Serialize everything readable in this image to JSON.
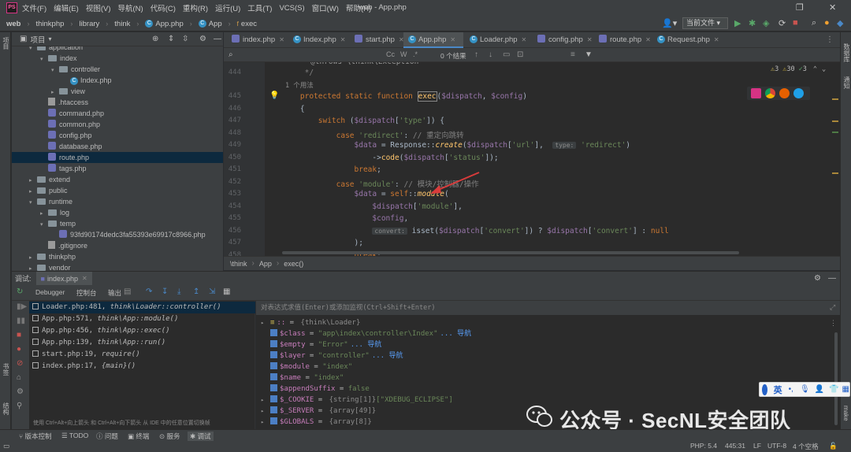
{
  "menubar": {
    "items": [
      "文件(F)",
      "编辑(E)",
      "视图(V)",
      "导航(N)",
      "代码(C)",
      "重构(R)",
      "运行(U)",
      "工具(T)",
      "VCS(S)",
      "窗口(W)",
      "帮助(H)"
    ],
    "title": "web - App.php"
  },
  "navbar": {
    "crumbs": [
      "web",
      "thinkphp",
      "library",
      "think",
      "App.php",
      "App",
      "exec"
    ],
    "run_config": "当前文件"
  },
  "project": {
    "title": "项目",
    "tree": [
      {
        "label": "application",
        "indent": 1,
        "kind": "folder",
        "arrow": "▾"
      },
      {
        "label": "index",
        "indent": 2,
        "kind": "folder",
        "arrow": "▾"
      },
      {
        "label": "controller",
        "indent": 3,
        "kind": "folder",
        "arrow": "▾"
      },
      {
        "label": "Index.php",
        "indent": 4,
        "kind": "class",
        "arrow": ""
      },
      {
        "label": "view",
        "indent": 3,
        "kind": "folder",
        "arrow": "▸"
      },
      {
        "label": ".htaccess",
        "indent": 2,
        "kind": "file",
        "arrow": ""
      },
      {
        "label": "command.php",
        "indent": 2,
        "kind": "php",
        "arrow": ""
      },
      {
        "label": "common.php",
        "indent": 2,
        "kind": "php",
        "arrow": ""
      },
      {
        "label": "config.php",
        "indent": 2,
        "kind": "php",
        "arrow": ""
      },
      {
        "label": "database.php",
        "indent": 2,
        "kind": "php",
        "arrow": ""
      },
      {
        "label": "route.php",
        "indent": 2,
        "kind": "php",
        "arrow": "",
        "selected": true
      },
      {
        "label": "tags.php",
        "indent": 2,
        "kind": "php",
        "arrow": ""
      },
      {
        "label": "extend",
        "indent": 1,
        "kind": "folder",
        "arrow": "▸"
      },
      {
        "label": "public",
        "indent": 1,
        "kind": "folder",
        "arrow": "▸"
      },
      {
        "label": "runtime",
        "indent": 1,
        "kind": "folder",
        "arrow": "▾"
      },
      {
        "label": "log",
        "indent": 2,
        "kind": "folder",
        "arrow": "▸"
      },
      {
        "label": "temp",
        "indent": 2,
        "kind": "folder",
        "arrow": "▾"
      },
      {
        "label": "93fd90174dedc3fa55393e69917c8966.php",
        "indent": 3,
        "kind": "php",
        "arrow": ""
      },
      {
        "label": ".gitignore",
        "indent": 2,
        "kind": "file",
        "arrow": ""
      },
      {
        "label": "thinkphp",
        "indent": 1,
        "kind": "folder",
        "arrow": "▸"
      },
      {
        "label": "vendor",
        "indent": 1,
        "kind": "folder",
        "arrow": "▸"
      }
    ]
  },
  "editor": {
    "tabs": [
      "index.php",
      "Index.php",
      "start.php",
      "App.php",
      "Loader.php",
      "config.php",
      "route.php",
      "Request.php"
    ],
    "active_tab": "App.php",
    "find_results": "0 个结果",
    "inspections": {
      "warnings": "3",
      "weak": "30",
      "typos": "3"
    },
    "usages_hint": "1 个用法",
    "lines": [
      {
        "n": "444",
        "html": "<span class=\"cmt\">     */</span>"
      },
      {
        "n": "445",
        "html": "    <span class=\"kw\">protected static function</span> <span class=\"fn\" style=\"border:1px solid #888;\">exec</span>(<span class=\"var\">$dispatch</span>, <span class=\"var\">$config</span>)"
      },
      {
        "n": "446",
        "html": "    {"
      },
      {
        "n": "447",
        "html": "        <span class=\"kw\">switch</span> (<span class=\"var\">$dispatch</span>[<span class=\"str\">'type'</span>]) {"
      },
      {
        "n": "448",
        "html": "            <span class=\"kw\">case</span> <span class=\"str\">'redirect'</span>: <span class=\"cmt\">// 重定向跳转</span>"
      },
      {
        "n": "449",
        "html": "                <span class=\"var\">$data</span> = Response::<span class=\"it\">create</span>(<span class=\"var\">$dispatch</span>[<span class=\"str\">'url'</span>],  <span class=\"hint\">type:</span> <span class=\"str\">'redirect'</span>)"
      },
      {
        "n": "450",
        "html": "                    -><span class=\"fn\">code</span>(<span class=\"var\">$dispatch</span>[<span class=\"str\">'status'</span>]);"
      },
      {
        "n": "451",
        "html": "                <span class=\"kw\">break</span>;"
      },
      {
        "n": "452",
        "html": "            <span class=\"kw\">case</span> <span class=\"str\">'module'</span>: <span class=\"cmt\">// 模块/控制器/操作</span>"
      },
      {
        "n": "453",
        "html": "                <span class=\"var\">$data</span> = <span class=\"kw\">self</span>::<span class=\"it\">module</span>("
      },
      {
        "n": "454",
        "html": "                    <span class=\"var\">$dispatch</span>[<span class=\"str\">'module'</span>],"
      },
      {
        "n": "455",
        "html": "                    <span class=\"var\">$config</span>,"
      },
      {
        "n": "456",
        "html": "                    <span class=\"hint\">convert:</span> isset(<span class=\"var\">$dispatch</span>[<span class=\"str\">'convert'</span>]) ? <span class=\"var\">$dispatch</span>[<span class=\"str\">'convert'</span>] : <span class=\"kw\">null</span>"
      },
      {
        "n": "457",
        "html": "                );"
      },
      {
        "n": "458",
        "html": "                <span class=\"kw\">break</span>;"
      }
    ],
    "breadcrumb": [
      "\\think",
      "App",
      "exec()"
    ]
  },
  "debug": {
    "label": "调试:",
    "session_tab": "index.php",
    "tabs": [
      "Debugger",
      "控制台",
      "输出"
    ],
    "frames": [
      {
        "file": "Loader.php:481,",
        "fn": "think\\Loader::controller()",
        "selected": true
      },
      {
        "file": "App.php:571,",
        "fn": "think\\App::module()"
      },
      {
        "file": "App.php:456,",
        "fn": "think\\App::exec()"
      },
      {
        "file": "App.php:139,",
        "fn": "think\\App::run()"
      },
      {
        "file": "start.php:19,",
        "fn": "require()"
      },
      {
        "file": "index.php:17,",
        "fn": "{main}()"
      }
    ],
    "frames_hint": "使用 Ctrl+Alt+向上箭头 和 Ctrl+Alt+向下箭头 从 IDE 中的任意位置切换帧",
    "eval_placeholder": "对表达式求值(Enter)或添加监视(Ctrl+Shift+Enter)",
    "vars": [
      {
        "arrow": "▸",
        "box": false,
        "name": "::",
        "eq": " = ",
        "type": "{think\\Loader}",
        "val": "",
        "nav": ""
      },
      {
        "arrow": "",
        "box": true,
        "name": "$class",
        "eq": " = ",
        "type": "",
        "val": "\"app\\index\\controller\\Index\"",
        "nav": "... 导航"
      },
      {
        "arrow": "",
        "box": true,
        "name": "$empty",
        "eq": " = ",
        "type": "",
        "val": "\"Error\"",
        "nav": "... 导航"
      },
      {
        "arrow": "",
        "box": true,
        "name": "$layer",
        "eq": " = ",
        "type": "",
        "val": "\"controller\"",
        "nav": "... 导航"
      },
      {
        "arrow": "",
        "box": true,
        "name": "$module",
        "eq": " = ",
        "type": "",
        "val": "\"index\"",
        "nav": ""
      },
      {
        "arrow": "",
        "box": true,
        "name": "$name",
        "eq": " = ",
        "type": "",
        "val": "\"index\"",
        "nav": ""
      },
      {
        "arrow": "",
        "box": true,
        "name": "$appendSuffix",
        "eq": " = ",
        "type": "",
        "val": "false",
        "nav": ""
      },
      {
        "arrow": "▸",
        "box": true,
        "name": "$_COOKIE",
        "eq": " = ",
        "type": "{string[1]}",
        "val": "[\"XDEBUG_ECLIPSE\"]",
        "nav": ""
      },
      {
        "arrow": "▸",
        "box": true,
        "name": "$_SERVER",
        "eq": " = ",
        "type": "{array[49]}",
        "val": "",
        "nav": ""
      },
      {
        "arrow": "▸",
        "box": true,
        "name": "$GLOBALS",
        "eq": " = ",
        "type": "{array[8]}",
        "val": "",
        "nav": ""
      }
    ]
  },
  "bottom_tools": [
    "版本控制",
    "TODO",
    "问题",
    "终端",
    "服务",
    "调试"
  ],
  "status": {
    "php": "PHP: 5.4",
    "position": "445:31",
    "line_sep": "LF",
    "encoding": "UTF-8",
    "indent": "4 个空格"
  },
  "watermark": "公众号 · SecNL安全团队",
  "ime": {
    "lang": "英"
  },
  "left_strip": [
    "项目",
    "书签",
    "结构"
  ],
  "right_strip": [
    "数据库",
    "通知",
    "make"
  ],
  "colors": {
    "accent": "#4a88c7",
    "selection": "#0d293e",
    "arrow": "#d93b3b"
  }
}
